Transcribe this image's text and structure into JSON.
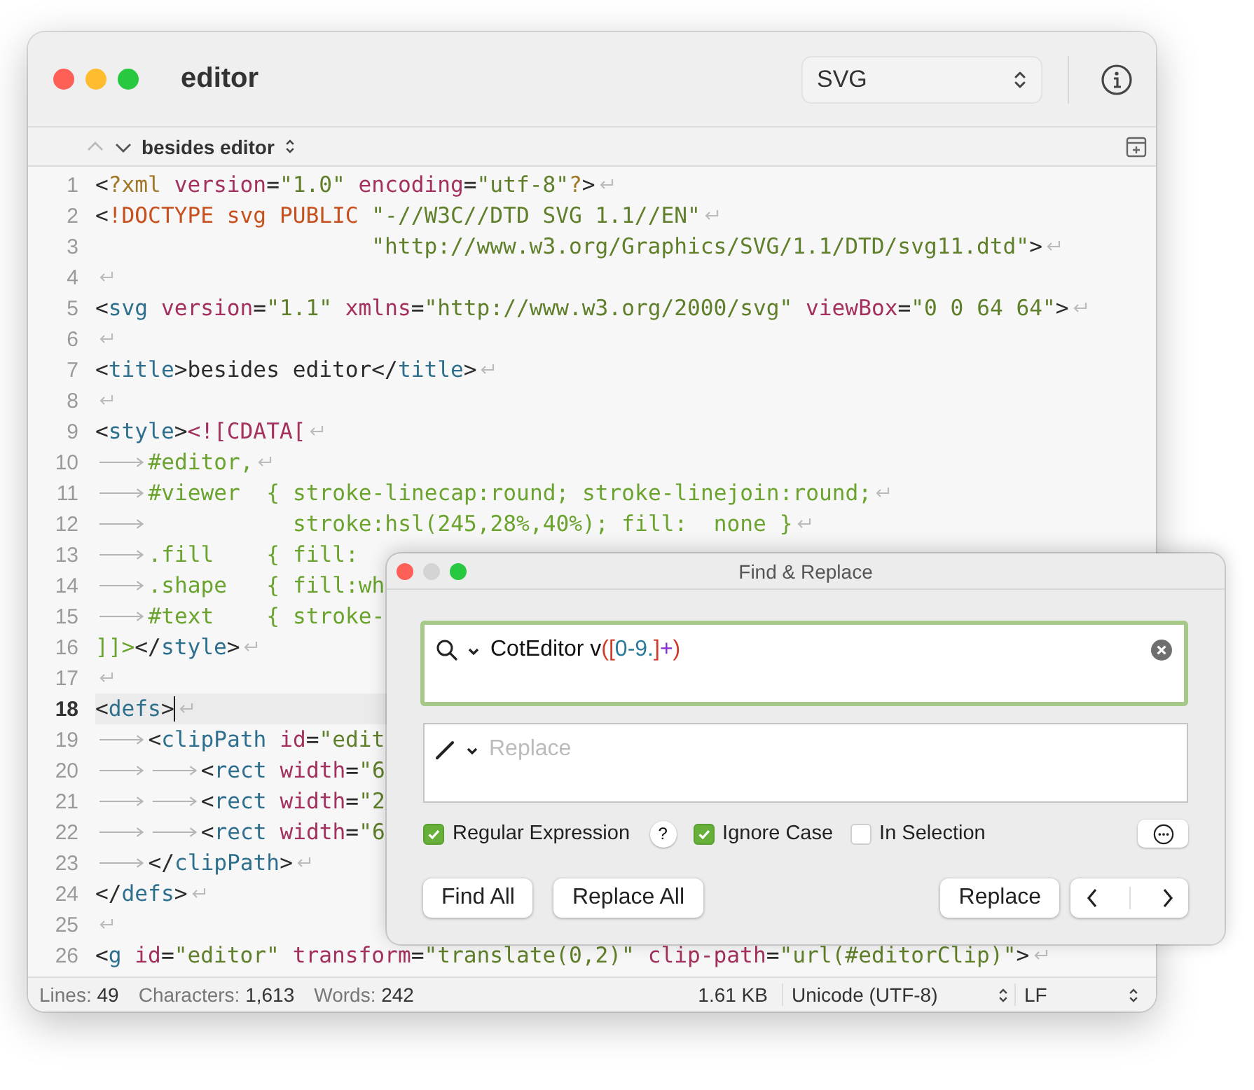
{
  "window": {
    "title": "editor",
    "syntax": "SVG"
  },
  "path_bar": {
    "outline": "besides editor"
  },
  "lines": [
    {
      "number": "1",
      "current": false,
      "eol": true,
      "tokens": [
        {
          "kind": "punct",
          "text": "<"
        },
        {
          "kind": "decl",
          "text": "?xml"
        },
        {
          "kind": "attr",
          "text": " version"
        },
        {
          "kind": "punct",
          "text": "="
        },
        {
          "kind": "string",
          "text": "\"1.0\""
        },
        {
          "kind": "attr",
          "text": " encoding"
        },
        {
          "kind": "punct",
          "text": "="
        },
        {
          "kind": "string",
          "text": "\"utf-8\""
        },
        {
          "kind": "decl",
          "text": "?"
        },
        {
          "kind": "punct",
          "text": ">"
        }
      ]
    },
    {
      "number": "2",
      "current": false,
      "eol": true,
      "tokens": [
        {
          "kind": "punct",
          "text": "<"
        },
        {
          "kind": "doctype",
          "text": "!DOCTYPE svg PUBLIC"
        },
        {
          "kind": "string",
          "text": " \"-//W3C//DTD SVG 1.1//EN\""
        }
      ]
    },
    {
      "number": "3",
      "current": false,
      "eol": true,
      "tokens": [
        {
          "kind": "string",
          "text": "                     \"http://www.w3.org/Graphics/SVG/1.1/DTD/svg11.dtd\""
        },
        {
          "kind": "punct",
          "text": ">"
        }
      ]
    },
    {
      "number": "4",
      "current": false,
      "eol": true
    },
    {
      "number": "5",
      "current": false,
      "eol": true,
      "tokens": [
        {
          "kind": "punct",
          "text": "<"
        },
        {
          "kind": "tag",
          "text": "svg"
        },
        {
          "kind": "attr",
          "text": " version"
        },
        {
          "kind": "punct",
          "text": "="
        },
        {
          "kind": "string",
          "text": "\"1.1\""
        },
        {
          "kind": "attr",
          "text": " xmlns"
        },
        {
          "kind": "punct",
          "text": "="
        },
        {
          "kind": "string",
          "text": "\"http://www.w3.org/2000/svg\""
        },
        {
          "kind": "attr",
          "text": " viewBox"
        },
        {
          "kind": "punct",
          "text": "="
        },
        {
          "kind": "string",
          "text": "\"0 0 64 64\""
        },
        {
          "kind": "punct",
          "text": ">"
        }
      ]
    },
    {
      "number": "6",
      "current": false,
      "eol": true
    },
    {
      "number": "7",
      "current": false,
      "eol": true,
      "tokens": [
        {
          "kind": "punct",
          "text": "<"
        },
        {
          "kind": "tag",
          "text": "title"
        },
        {
          "kind": "punct",
          "text": ">"
        },
        {
          "kind": "plain",
          "text": "besides editor"
        },
        {
          "kind": "punct",
          "text": "</"
        },
        {
          "kind": "tag",
          "text": "title"
        },
        {
          "kind": "punct",
          "text": ">"
        }
      ]
    },
    {
      "number": "8",
      "current": false,
      "eol": true
    },
    {
      "number": "9",
      "current": false,
      "eol": true,
      "tokens": [
        {
          "kind": "punct",
          "text": "<"
        },
        {
          "kind": "tag",
          "text": "style"
        },
        {
          "kind": "punct",
          "text": ">"
        },
        {
          "kind": "cdata",
          "text": "<![CDATA["
        }
      ]
    },
    {
      "number": "10",
      "current": false,
      "eol": true,
      "tokens": [
        {
          "kind": "tab"
        },
        {
          "kind": "css",
          "text": "#editor,"
        }
      ]
    },
    {
      "number": "11",
      "current": false,
      "eol": true,
      "tokens": [
        {
          "kind": "tab"
        },
        {
          "kind": "css",
          "text": "#viewer  { stroke-linecap:round; stroke-linejoin:round;"
        }
      ]
    },
    {
      "number": "12",
      "current": false,
      "eol": true,
      "tokens": [
        {
          "kind": "tab"
        },
        {
          "kind": "css",
          "text": "           stroke:hsl(245,28%,40%); fill:  none }"
        }
      ]
    },
    {
      "number": "13",
      "current": false,
      "eol": false,
      "tokens": [
        {
          "kind": "tab"
        },
        {
          "kind": "css",
          "text": ".fill    { fill:"
        }
      ]
    },
    {
      "number": "14",
      "current": false,
      "eol": false,
      "tokens": [
        {
          "kind": "tab"
        },
        {
          "kind": "css",
          "text": ".shape   { fill:wh"
        }
      ]
    },
    {
      "number": "15",
      "current": false,
      "eol": false,
      "tokens": [
        {
          "kind": "tab"
        },
        {
          "kind": "css",
          "text": "#text    { stroke-"
        }
      ]
    },
    {
      "number": "16",
      "current": false,
      "eol": true,
      "tokens": [
        {
          "kind": "css",
          "text": "]]>"
        },
        {
          "kind": "punct",
          "text": "</"
        },
        {
          "kind": "tag",
          "text": "style"
        },
        {
          "kind": "punct",
          "text": ">"
        }
      ]
    },
    {
      "number": "17",
      "current": false,
      "eol": true
    },
    {
      "number": "18",
      "current": true,
      "eol": true,
      "tokens": [
        {
          "kind": "punct",
          "text": "<"
        },
        {
          "kind": "tag",
          "text": "defs"
        },
        {
          "kind": "punct",
          "text": ">"
        }
      ]
    },
    {
      "number": "19",
      "current": false,
      "eol": false,
      "tokens": [
        {
          "kind": "tab"
        },
        {
          "kind": "punct",
          "text": "<"
        },
        {
          "kind": "tag",
          "text": "clipPath"
        },
        {
          "kind": "attr",
          "text": " id"
        },
        {
          "kind": "punct",
          "text": "="
        },
        {
          "kind": "string",
          "text": "\"edit"
        }
      ]
    },
    {
      "number": "20",
      "current": false,
      "eol": false,
      "tokens": [
        {
          "kind": "tab"
        },
        {
          "kind": "tab"
        },
        {
          "kind": "punct",
          "text": "<"
        },
        {
          "kind": "tag",
          "text": "rect"
        },
        {
          "kind": "attr",
          "text": " width"
        },
        {
          "kind": "punct",
          "text": "="
        },
        {
          "kind": "string",
          "text": "\"6"
        }
      ]
    },
    {
      "number": "21",
      "current": false,
      "eol": false,
      "tokens": [
        {
          "kind": "tab"
        },
        {
          "kind": "tab"
        },
        {
          "kind": "punct",
          "text": "<"
        },
        {
          "kind": "tag",
          "text": "rect"
        },
        {
          "kind": "attr",
          "text": " width"
        },
        {
          "kind": "punct",
          "text": "="
        },
        {
          "kind": "string",
          "text": "\"2"
        }
      ]
    },
    {
      "number": "22",
      "current": false,
      "eol": false,
      "tokens": [
        {
          "kind": "tab"
        },
        {
          "kind": "tab"
        },
        {
          "kind": "punct",
          "text": "<"
        },
        {
          "kind": "tag",
          "text": "rect"
        },
        {
          "kind": "attr",
          "text": " width"
        },
        {
          "kind": "punct",
          "text": "="
        },
        {
          "kind": "string",
          "text": "\"6"
        }
      ]
    },
    {
      "number": "23",
      "current": false,
      "eol": true,
      "tokens": [
        {
          "kind": "tab"
        },
        {
          "kind": "punct",
          "text": "</"
        },
        {
          "kind": "tag",
          "text": "clipPath"
        },
        {
          "kind": "punct",
          "text": ">"
        }
      ]
    },
    {
      "number": "24",
      "current": false,
      "eol": true,
      "tokens": [
        {
          "kind": "punct",
          "text": "</"
        },
        {
          "kind": "tag",
          "text": "defs"
        },
        {
          "kind": "punct",
          "text": ">"
        }
      ]
    },
    {
      "number": "25",
      "current": false,
      "eol": true
    },
    {
      "number": "26",
      "current": false,
      "eol": true,
      "tokens": [
        {
          "kind": "punct",
          "text": "<"
        },
        {
          "kind": "tag",
          "text": "g"
        },
        {
          "kind": "attr",
          "text": " id"
        },
        {
          "kind": "punct",
          "text": "="
        },
        {
          "kind": "string",
          "text": "\"editor\""
        },
        {
          "kind": "attr",
          "text": " transform"
        },
        {
          "kind": "punct",
          "text": "="
        },
        {
          "kind": "string",
          "text": "\"translate(0,2)\""
        },
        {
          "kind": "attr",
          "text": " clip-path"
        },
        {
          "kind": "punct",
          "text": "="
        },
        {
          "kind": "string",
          "text": "\"url(#editorClip)\""
        },
        {
          "kind": "punct",
          "text": ">"
        }
      ]
    }
  ],
  "status_bar": {
    "counts": [
      {
        "label": "Lines:",
        "value": "49"
      },
      {
        "label": "Characters:",
        "value": "1,613"
      },
      {
        "label": "Words:",
        "value": "242"
      }
    ],
    "size": "1.61 KB",
    "encoding": "Unicode (UTF-8)",
    "line_ending": "LF"
  },
  "find_panel": {
    "title": "Find & Replace",
    "find_tokens": [
      {
        "kind": "plain",
        "text": "CotEditor v"
      },
      {
        "kind": "group",
        "text": "("
      },
      {
        "kind": "group",
        "text": "["
      },
      {
        "kind": "class",
        "text": "0-9."
      },
      {
        "kind": "group",
        "text": "]"
      },
      {
        "kind": "quantifier",
        "text": "+"
      },
      {
        "kind": "group",
        "text": ")"
      }
    ],
    "replace": {
      "placeholder": "Replace"
    },
    "options": [
      {
        "label": "Regular Expression",
        "checked": true,
        "help": "?"
      },
      {
        "label": "Ignore Case",
        "checked": true
      },
      {
        "label": "In Selection",
        "checked": false
      }
    ],
    "buttons": [
      "Find All",
      "Replace All",
      "Replace"
    ]
  }
}
